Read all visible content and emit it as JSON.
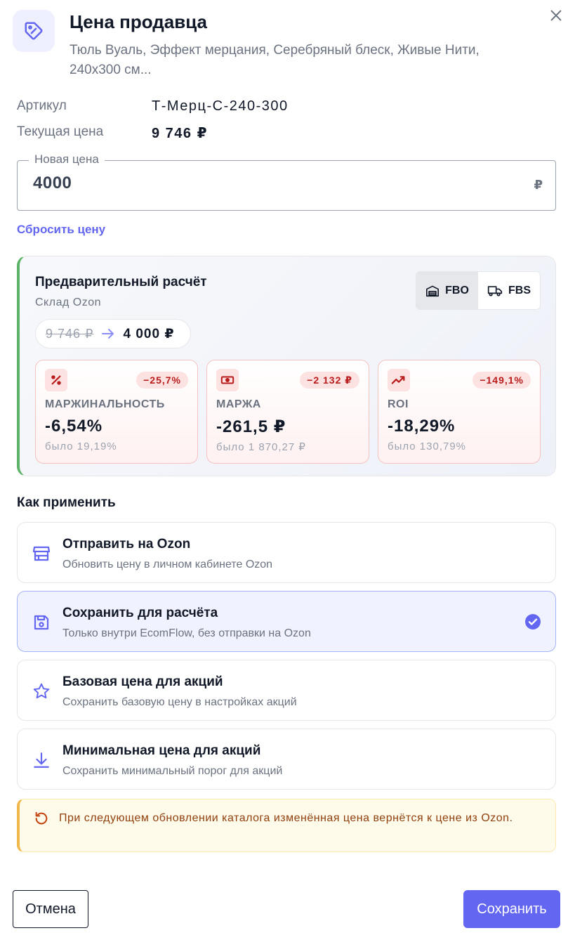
{
  "header": {
    "title": "Цена продавца",
    "subtitle": "Тюль Вуаль, Эффект мерцания, Серебряный блеск, Живые Нити, 240х300 см...",
    "icon": "price-tag-icon",
    "close_icon": "close-icon"
  },
  "info": {
    "sku_label": "Артикул",
    "sku_value": "Т-Мерц-С-240-300",
    "current_price_label": "Текущая цена",
    "current_price_value": "9 746 ₽"
  },
  "price_field": {
    "legend": "Новая цена",
    "value": "4000",
    "currency": "₽"
  },
  "reset_label": "Сбросить цену",
  "calc": {
    "title": "Предварительный расчёт",
    "subtitle": "Склад Ozon",
    "segments": [
      {
        "label": "FBO",
        "icon": "warehouse-icon",
        "active": true
      },
      {
        "label": "FBS",
        "icon": "truck-icon",
        "active": false
      }
    ],
    "old_price": "9 746 ₽",
    "new_price": "4 000 ₽",
    "metrics": [
      {
        "icon": "percent-icon",
        "badge": "−25,7%",
        "label": "МАРЖИНАЛЬНОСТЬ",
        "value": "-6,54%",
        "was": "было 19,19%"
      },
      {
        "icon": "banknote-icon",
        "badge": "−2 132 ₽",
        "label": "МАРЖА",
        "value": "-261,5 ₽",
        "was": "было 1 870,27 ₽"
      },
      {
        "icon": "trend-up-icon",
        "badge": "−149,1%",
        "label": "ROI",
        "value": "-18,29%",
        "was": "было 130,79%"
      }
    ]
  },
  "apply": {
    "title": "Как применить",
    "options": [
      {
        "icon": "store-icon",
        "title": "Отправить на Ozon",
        "desc": "Обновить цену в личном кабинете Ozon",
        "selected": false
      },
      {
        "icon": "save-icon",
        "title": "Сохранить для расчёта",
        "desc": "Только внутри EcomFlow, без отправки на Ozon",
        "selected": true
      },
      {
        "icon": "star-icon",
        "title": "Базовая цена для акций",
        "desc": "Сохранить базовую цену в настройках акций",
        "selected": false
      },
      {
        "icon": "download-icon",
        "title": "Минимальная цена для акций",
        "desc": "Сохранить минимальный порог для акций",
        "selected": false
      }
    ]
  },
  "notice": {
    "icon": "refresh-icon",
    "text": "При следующем обновлении каталога изменённая цена вернётся к цене из Ozon."
  },
  "footer": {
    "cancel_label": "Отмена",
    "save_label": "Сохранить"
  },
  "colors": {
    "accent": "#6366f1",
    "success_border": "#5db36a",
    "danger": "#b91c1c",
    "warning_border": "#f0b84a"
  }
}
